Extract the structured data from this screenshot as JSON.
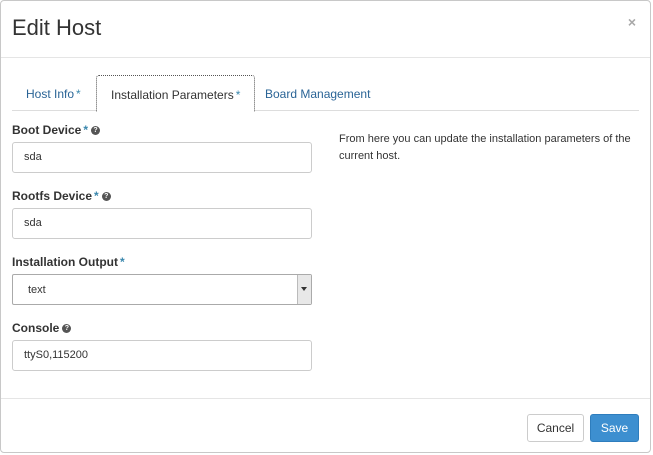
{
  "modal": {
    "title": "Edit Host",
    "close_label": "×"
  },
  "tabs": [
    {
      "label": "Host Info",
      "required_mark": "*"
    },
    {
      "label": "Installation Parameters",
      "required_mark": "*"
    },
    {
      "label": "Board Management"
    }
  ],
  "active_tab": "Installation Parameters",
  "form": {
    "boot_device": {
      "label": "Boot Device",
      "required_mark": "*",
      "value": "sda",
      "help_icon": "question-circle-icon"
    },
    "rootfs_device": {
      "label": "Rootfs Device",
      "required_mark": "*",
      "value": "sda",
      "help_icon": "question-circle-icon"
    },
    "installation_output": {
      "label": "Installation Output",
      "required_mark": "*",
      "selected": "text"
    },
    "console": {
      "label": "Console",
      "value": "ttyS0,115200",
      "help_icon": "question-circle-icon"
    }
  },
  "help_text": "From here you can update the installation parameters of the current host.",
  "footer": {
    "cancel_label": "Cancel",
    "save_label": "Save"
  },
  "colors": {
    "link": "#2a6496",
    "required": "#3a87ad",
    "primary_button": "#3d8fd0"
  }
}
